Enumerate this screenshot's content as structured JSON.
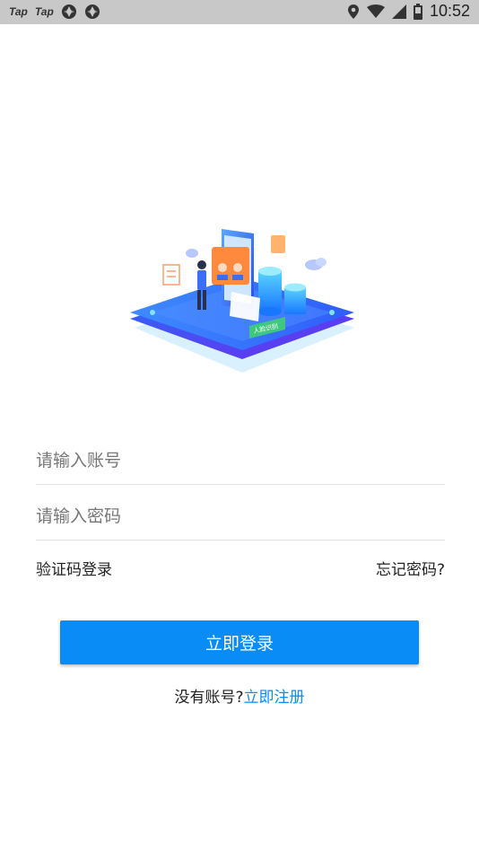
{
  "status_bar": {
    "left_labels": [
      "Tap",
      "Tap"
    ],
    "time": "10:52"
  },
  "form": {
    "account_placeholder": "请输入账号",
    "password_placeholder": "请输入密码",
    "sms_login": "验证码登录",
    "forgot_password": "忘记密码?",
    "login_button": "立即登录",
    "no_account_text": "没有账号?",
    "register_link": "立即注册"
  },
  "illustration": {
    "badge_text": "人脸识别"
  },
  "colors": {
    "accent": "#0a8cf7",
    "status_bar": "#c8c8c8",
    "divider": "#e3e3e3"
  }
}
